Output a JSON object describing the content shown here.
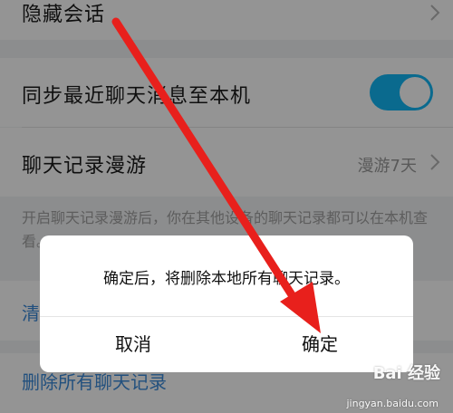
{
  "settings": {
    "hidden_chat_label": "隐藏会话",
    "sync_label": "同步最近聊天消息至本机",
    "sync_enabled": true,
    "roaming_label": "聊天记录漫游",
    "roaming_value": "漫游7天",
    "roaming_desc": "开启聊天记录漫游后，你在其他设备的聊天记录都可以在本机查看。",
    "clear_label": "清空聊天记录",
    "delete_all_label": "删除所有聊天记录"
  },
  "dialog": {
    "message": "确定后，将删除本地所有聊天记录。",
    "cancel_label": "取消",
    "confirm_label": "确定"
  },
  "watermark": {
    "logo": "Bai 经验",
    "url": "jingyan.baidu.com"
  },
  "colors": {
    "accent": "#12b7f5",
    "link": "#3b8ad9",
    "arrow": "#e8201c"
  }
}
